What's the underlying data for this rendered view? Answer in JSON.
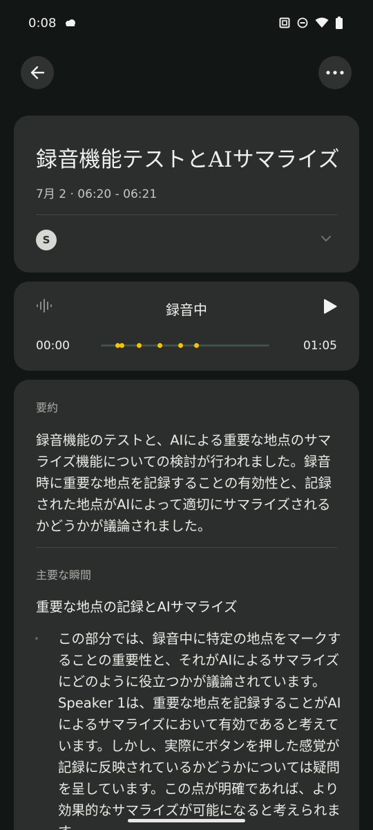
{
  "status_bar": {
    "time": "0:08",
    "icons": [
      "notification-icon",
      "nfc-icon",
      "dnd-icon",
      "wifi-icon",
      "battery-icon"
    ]
  },
  "app_bar": {
    "back_icon": "arrow-back-icon",
    "more_icon": "more-horiz-icon"
  },
  "recording": {
    "title": "録音機能テストとAIサマライズ",
    "date": "7月 2 · 06:20 - 06:21",
    "speaker_initial": "S"
  },
  "player": {
    "status": "録音中",
    "current_time": "00:00",
    "duration": "01:05",
    "colors": {
      "marker": "#f5c400",
      "track": "#415049"
    }
  },
  "summary": {
    "label": "要約",
    "text": "録音機能のテストと、AIによる重要な地点のサマライズ機能についての検討が行われました。録音時に重要な地点を記録することの有効性と、記録された地点がAIによって適切にサマライズされるかどうかが議論されました。"
  },
  "key_moments": {
    "label": "主要な瞬間",
    "heading": "重要な地点の記録とAIサマライズ",
    "bullet_text": "この部分では、録音中に特定の地点をマークすることの重要性と、それがAIによるサマライズにどのように役立つかが議論されています。Speaker 1は、重要な地点を記録することがAIによるサマライズにおいて有効であると考えています。しかし、実際にボタンを押した感覚が記録に反映されているかどうかについては疑問を呈しています。この点が明確であれば、より効果的なサマライズが可能になると考えられます。"
  },
  "colors": {
    "background": "#121614",
    "card": "#2b2e2c",
    "text": "#e9ebe7",
    "muted": "#a9ada8"
  }
}
